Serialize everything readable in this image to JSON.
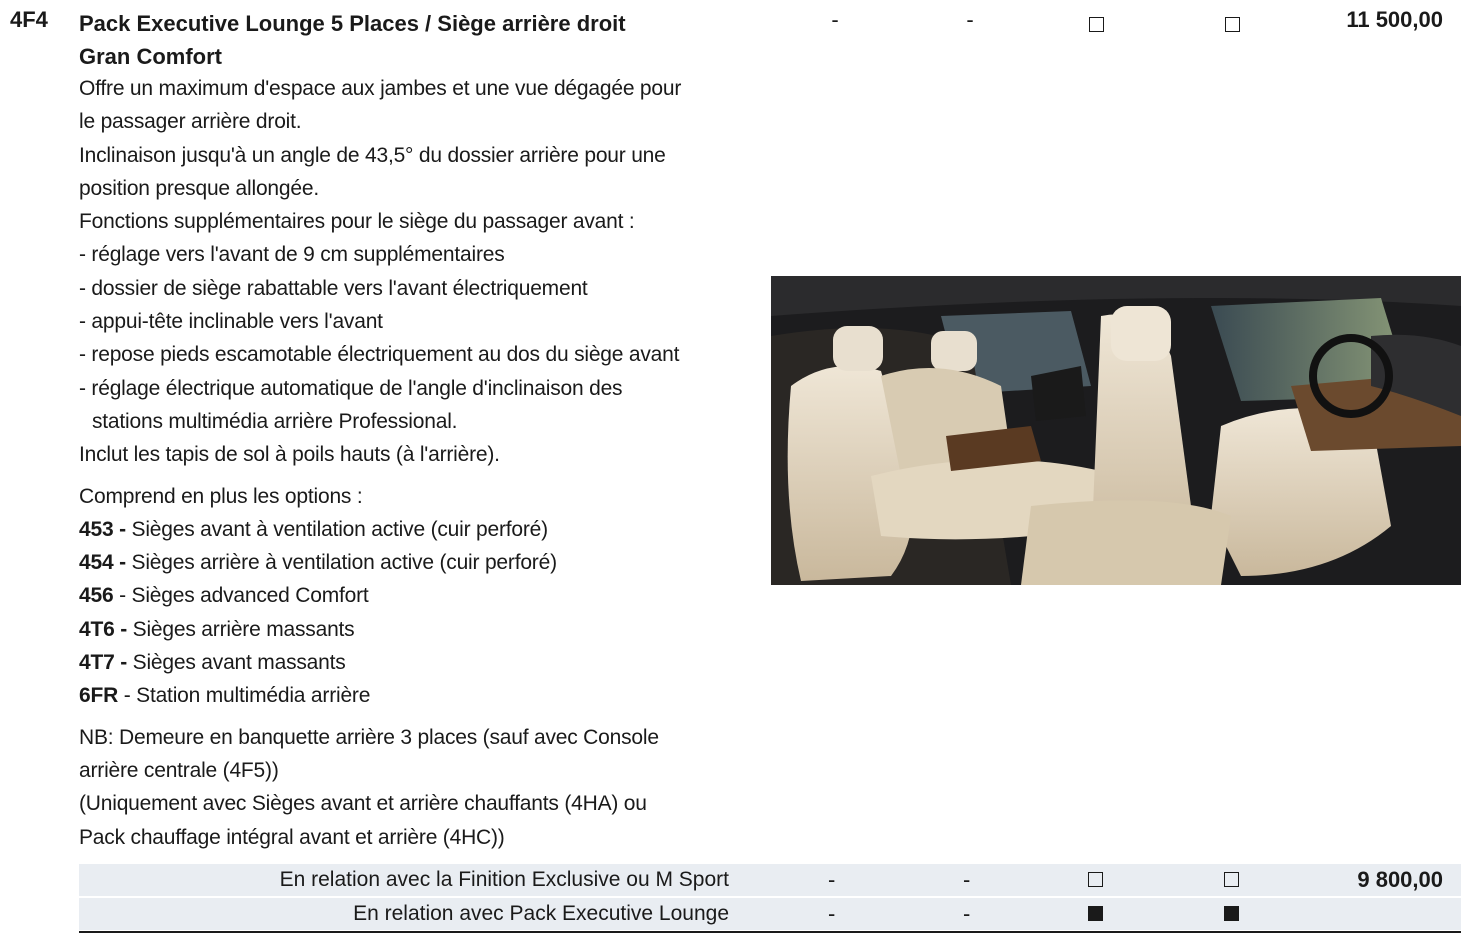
{
  "header": {
    "code": "4F4",
    "title_line1": "Pack Executive Lounge 5 Places / Siège arrière droit",
    "title_line2": "Gran Comfort",
    "col1": "-",
    "col2": "-",
    "price": "11 500,00"
  },
  "description": {
    "lines": [
      "Offre un maximum d'espace aux jambes et une vue dégagée pour",
      "le passager arrière droit.",
      "Inclinaison jusqu'à un angle de 43,5° du dossier arrière pour une",
      "position presque allongée.",
      "Fonctions supplémentaires pour le siège du passager avant :",
      "- réglage vers l'avant de 9 cm supplémentaires",
      "- dossier de siège rabattable vers l'avant électriquement",
      "- appui-tête inclinable vers l'avant",
      "- repose pieds escamotable électriquement au dos du siège avant",
      "- réglage électrique automatique de l'angle d'inclinaison des",
      "stations multimédia arrière Professional.",
      "Inclut les tapis de sol à poils hauts (à l'arrière)."
    ],
    "includes_label": "Comprend en plus les options :",
    "options": [
      {
        "code": "453 -",
        "text": " Sièges avant à ventilation active (cuir perforé)"
      },
      {
        "code": "454 -",
        "text": " Sièges arrière à ventilation active (cuir perforé)"
      },
      {
        "code": "456",
        "text": " - Sièges advanced Comfort"
      },
      {
        "code": "4T6 -",
        "text": " Sièges arrière massants"
      },
      {
        "code": "4T7 -",
        "text": " Sièges avant massants"
      },
      {
        "code": "6FR",
        "text": " - Station multimédia arrière"
      }
    ],
    "notes": [
      "NB: Demeure en banquette arrière 3 places (sauf avec Console",
      "arrière centrale (4F5))",
      "(Uniquement avec Sièges avant et arrière chauffants (4HA) ou",
      "Pack chauffage intégral avant et arrière (4HC))"
    ]
  },
  "rows": [
    {
      "label": "En relation avec la Finition Exclusive ou M Sport",
      "col1": "-",
      "col2": "-",
      "box3": "empty",
      "box4": "empty",
      "price": "9 800,00"
    },
    {
      "label": "En relation avec Pack Executive Lounge",
      "col1": "-",
      "col2": "-",
      "box3": "filled",
      "box4": "filled",
      "price": ""
    }
  ]
}
